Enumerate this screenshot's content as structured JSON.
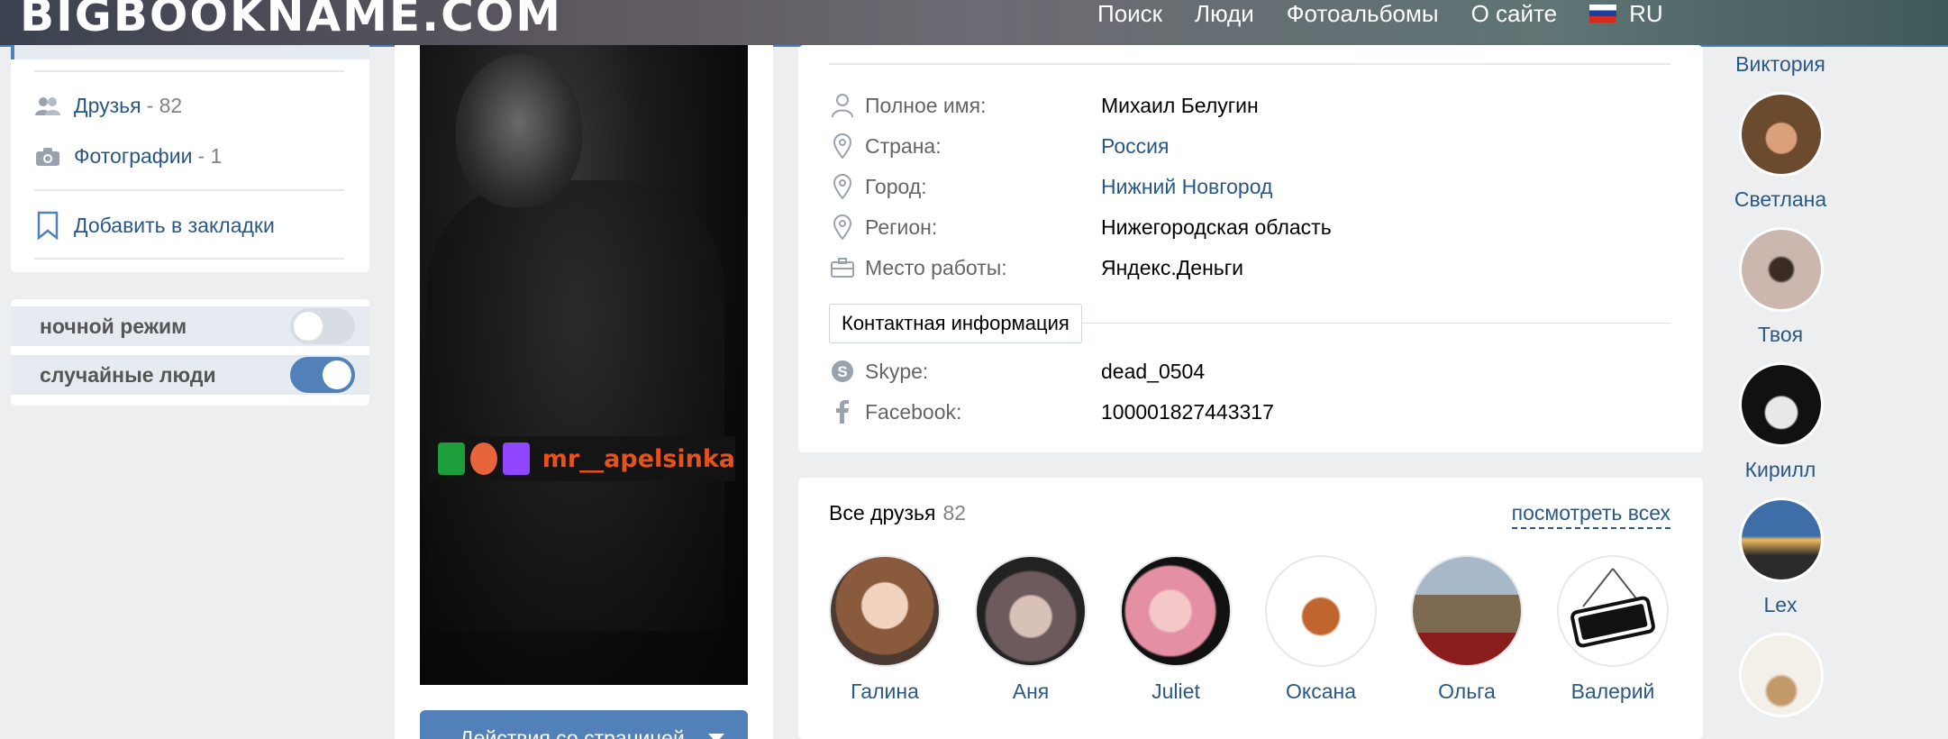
{
  "header": {
    "brand": "BIGBOOKNAME.COM",
    "nav": [
      "Поиск",
      "Люди",
      "Фотоальбомы",
      "О сайте"
    ],
    "lang": "RU"
  },
  "left": {
    "friends_label": "Друзья",
    "friends_count": "- 82",
    "photos_label": "Фотографии",
    "photos_count": "- 1",
    "bookmark_label": "Добавить в закладки",
    "toggles": [
      {
        "label": "ночной режим",
        "on": false
      },
      {
        "label": "случайные люди",
        "on": true
      }
    ]
  },
  "photo": {
    "nickname": "mr__apelsinka",
    "actions_label": "Действия со страницей"
  },
  "info": {
    "rows": [
      {
        "label": "Полное имя:",
        "value": "Михаил Белугин",
        "icon": "user-icon"
      },
      {
        "label": "Страна:",
        "value": "Россия",
        "icon": "location-pin-icon"
      },
      {
        "label": "Город:",
        "value": "Нижний Новгород",
        "icon": "location-pin-icon"
      },
      {
        "label": "Регион:",
        "value": "Нижегородская область",
        "icon": "location-pin-icon"
      },
      {
        "label": "Место работы:",
        "value": "Яндекс.Деньги",
        "icon": "briefcase-icon"
      }
    ],
    "contact_button": "Контактная информация",
    "contacts": [
      {
        "label": "Skype:",
        "value": "dead_0504",
        "icon": "skype-icon"
      },
      {
        "label": "Facebook:",
        "value": "100001827443317",
        "icon": "facebook-icon"
      }
    ]
  },
  "friends": {
    "title": "Все друзья",
    "count": "82",
    "view_all": "посмотреть всех",
    "items": [
      {
        "name": "Галина",
        "color": "#8a5a3c"
      },
      {
        "name": "Аня",
        "color": "#6d5a5c"
      },
      {
        "name": "Juliet",
        "color": "#e58fa5"
      },
      {
        "name": "Оксана",
        "color": "#c0652e"
      },
      {
        "name": "Ольга",
        "color": "#7c6a50"
      },
      {
        "name": "Валерий",
        "color": "#ffffff"
      }
    ]
  },
  "right": {
    "names": [
      "Виктория",
      "Светлана",
      "Твоя",
      "Кирилл",
      "Lex"
    ]
  },
  "colors": {
    "link": "#2a5885",
    "accent": "#5181b8",
    "nickname": "#e8501c"
  }
}
